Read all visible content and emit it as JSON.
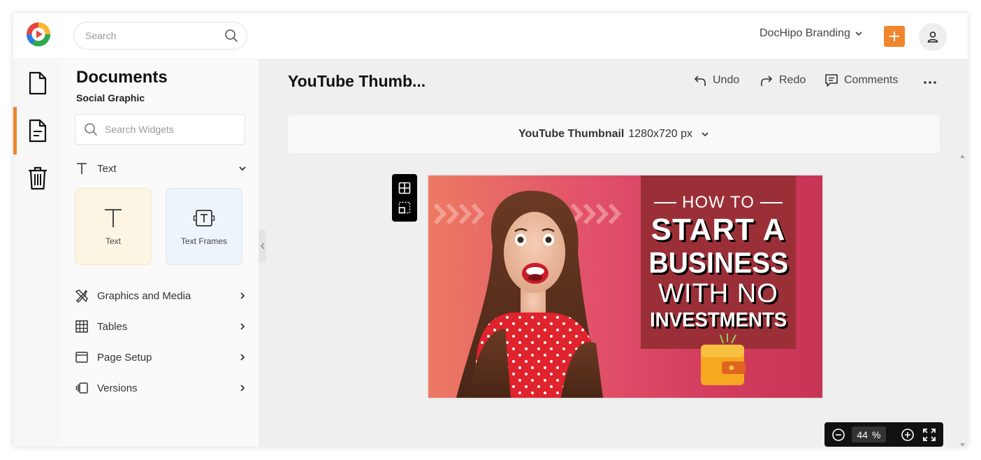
{
  "topbar": {
    "search_placeholder": "Search",
    "brand_label": "DocHipo Branding"
  },
  "panel": {
    "title": "Documents",
    "subtitle": "Social Graphic",
    "widget_search_placeholder": "Search Widgets",
    "text_section": "Text",
    "tiles": [
      {
        "label": "Text"
      },
      {
        "label": "Text Frames"
      }
    ],
    "sections": [
      {
        "label": "Graphics and Media"
      },
      {
        "label": "Tables"
      },
      {
        "label": "Page Setup"
      },
      {
        "label": "Versions"
      }
    ]
  },
  "header": {
    "doc_title": "YouTube Thumb...",
    "undo_label": "Undo",
    "redo_label": "Redo",
    "comments_label": "Comments"
  },
  "sizebar": {
    "format": "YouTube Thumbnail",
    "dimensions": "1280x720 px"
  },
  "thumbnail": {
    "line1": "HOW TO",
    "line2": "START A",
    "line3": "BUSINESS",
    "line4": "WITH NO",
    "line5": "INVESTMENTS"
  },
  "zoom": {
    "value": "44",
    "unit": "%"
  },
  "colors": {
    "accent": "#f0852d",
    "canvas_panel": "#9b2f38"
  }
}
